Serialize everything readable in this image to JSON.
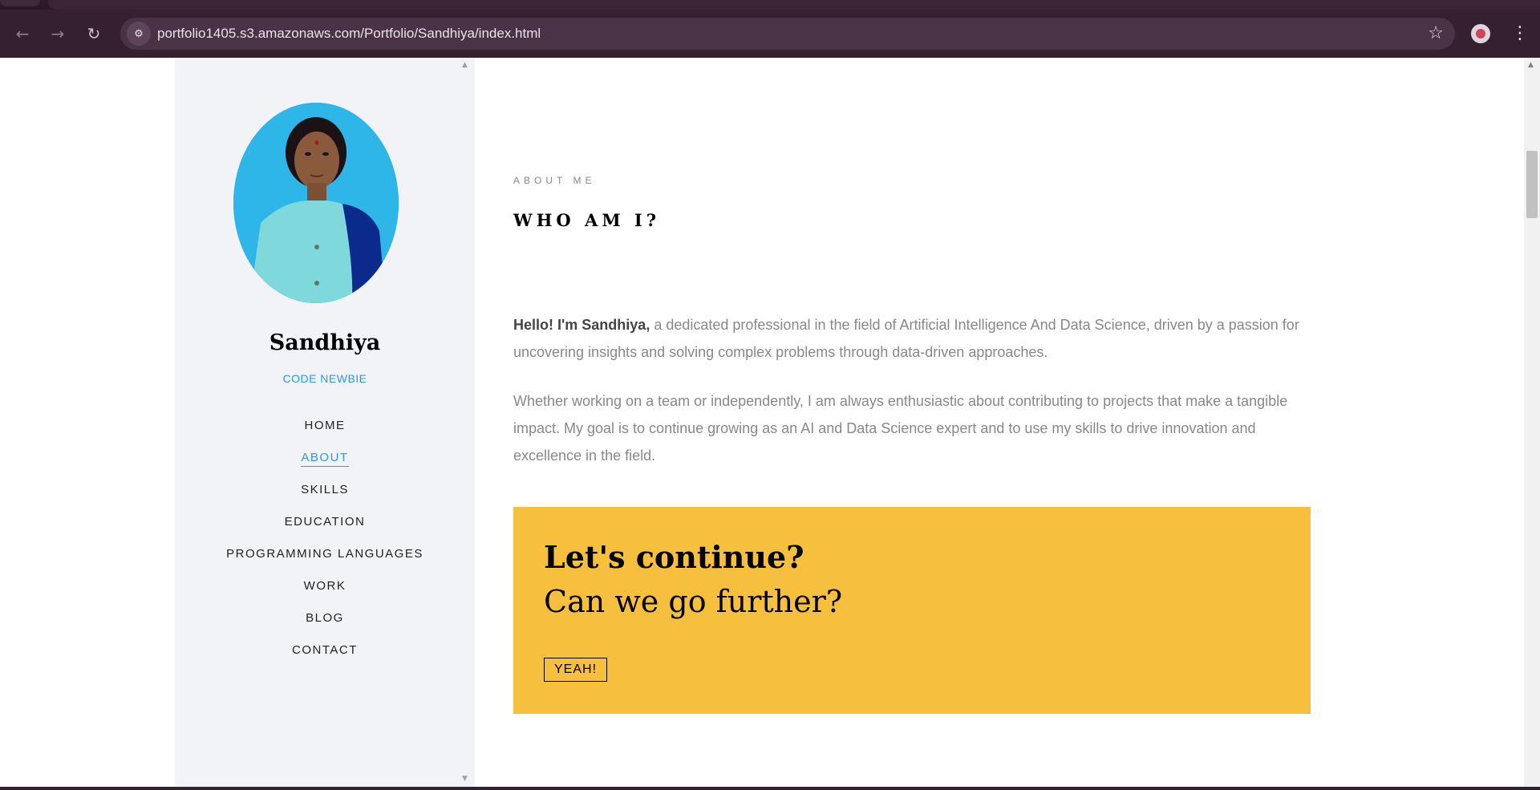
{
  "browser": {
    "url_host": "portfolio1405.s3.amazonaws.com",
    "url_path": "/Portfolio/Sandhiya/index.html",
    "icons": {
      "back": "arrow-left-icon",
      "forward": "arrow-right-icon",
      "reload": "reload-icon",
      "site_info": "tune-icon",
      "bookmark": "star-icon",
      "menu": "kebab-icon"
    }
  },
  "sidebar": {
    "name": "Sandhiya",
    "tagline": "CODE NEWBIE",
    "menu": [
      {
        "label": "HOME",
        "active": false
      },
      {
        "label": "ABOUT",
        "active": true
      },
      {
        "label": "SKILLS",
        "active": false
      },
      {
        "label": "EDUCATION",
        "active": false
      },
      {
        "label": "PROGRAMMING LANGUAGES",
        "active": false
      },
      {
        "label": "WORK",
        "active": false
      },
      {
        "label": "BLOG",
        "active": false
      },
      {
        "label": "CONTACT",
        "active": false
      }
    ]
  },
  "about": {
    "eyebrow": "ABOUT ME",
    "heading": "WHO AM I?",
    "intro_bold": "Hello! I'm Sandhiya,",
    "intro_rest": " a dedicated professional in the field of Artificial Intelligence And Data Science, driven by a passion for uncovering insights and solving complex problems through data-driven approaches.",
    "paragraph2": "Whether working on a team or independently, I am always enthusiastic about contributing to projects that make a tangible impact. My goal is to continue growing as an AI and Data Science expert and to use my skills to drive innovation and excellence in the field."
  },
  "cta": {
    "title": "Let's continue?",
    "subtitle": "Can we go further?",
    "button": "YEAH!"
  },
  "colors": {
    "accent": "#2c98f0",
    "cta_background": "#f7bf3e",
    "sidebar_background": "#f2f3f7",
    "chrome_background": "#35202f"
  }
}
